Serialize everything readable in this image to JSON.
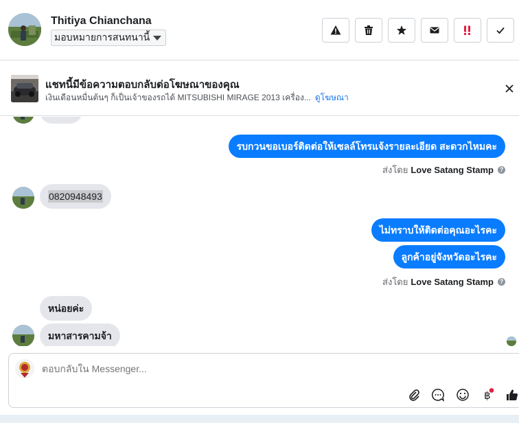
{
  "header": {
    "contact_name": "Thitiya Chianchana",
    "assign_label": "มอบหมายการสนทนานี้",
    "tools": [
      {
        "name": "report-spam-button",
        "icon": "warning-icon"
      },
      {
        "name": "delete-button",
        "icon": "trash-icon"
      },
      {
        "name": "star-button",
        "icon": "star-icon"
      },
      {
        "name": "mark-unread-button",
        "icon": "envelope-icon"
      },
      {
        "name": "follow-up-button",
        "icon": "follow-up-icon"
      },
      {
        "name": "mark-done-button",
        "icon": "check-icon"
      }
    ]
  },
  "ad": {
    "title": "แชทนี้มีข้อความตอบกลับต่อโฆษณาของคุณ",
    "description": "เงินเดือนหมื่นต้นๆ ก็เป็นเจ้าของรถได้ MITSUBISHI MIRAGE 2013 เครื่อง...",
    "link": "ดูโฆษณา"
  },
  "messages": {
    "out1": "รบกวนขอเบอร์ติดต่อให้เซลล์โทรแจ้งรายละเอียด สะดวกไหมคะ",
    "sent_by_prefix": "ส่งโดย",
    "sent_by_name": "Love Satang Stamp",
    "in1": "0820948493",
    "out2": "ไม่ทราบให้ติดต่อคุณอะไรคะ",
    "out3": "ลูกค้าอยู่จังหวัดอะไรคะ",
    "sent_by_prefix2": "ส่งโดย",
    "sent_by_name2": "Love Satang Stamp",
    "in2": "หน่อยค่ะ",
    "in3": "มหาสารคามจ้า"
  },
  "composer": {
    "placeholder": "ตอบกลับใน Messenger..."
  },
  "colors": {
    "outgoing_bubble": "#0a7cff",
    "incoming_bubble": "#e4e6eb",
    "link": "#1877f2",
    "follow_up": "#e41e3f"
  }
}
